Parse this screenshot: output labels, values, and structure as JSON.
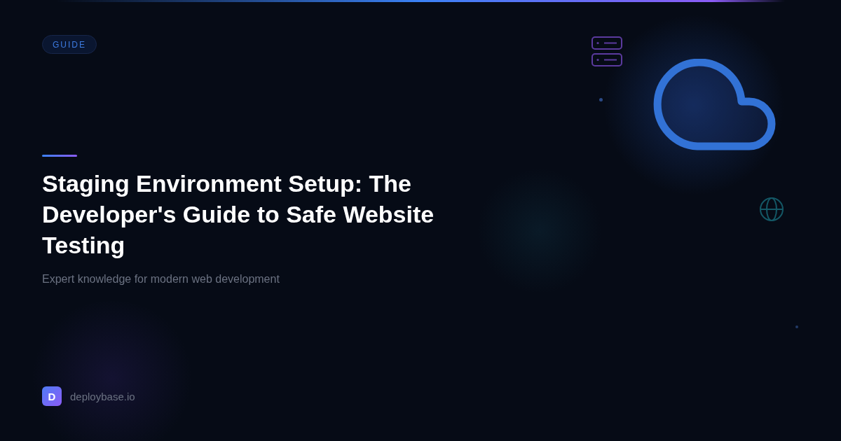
{
  "badge": {
    "label": "GUIDE"
  },
  "title": "Staging Environment Setup: The Developer's Guide to Safe Website Testing",
  "subtitle": "Expert knowledge for modern web development",
  "brand": {
    "logo_letter": "D",
    "name": "deploybase.io"
  }
}
